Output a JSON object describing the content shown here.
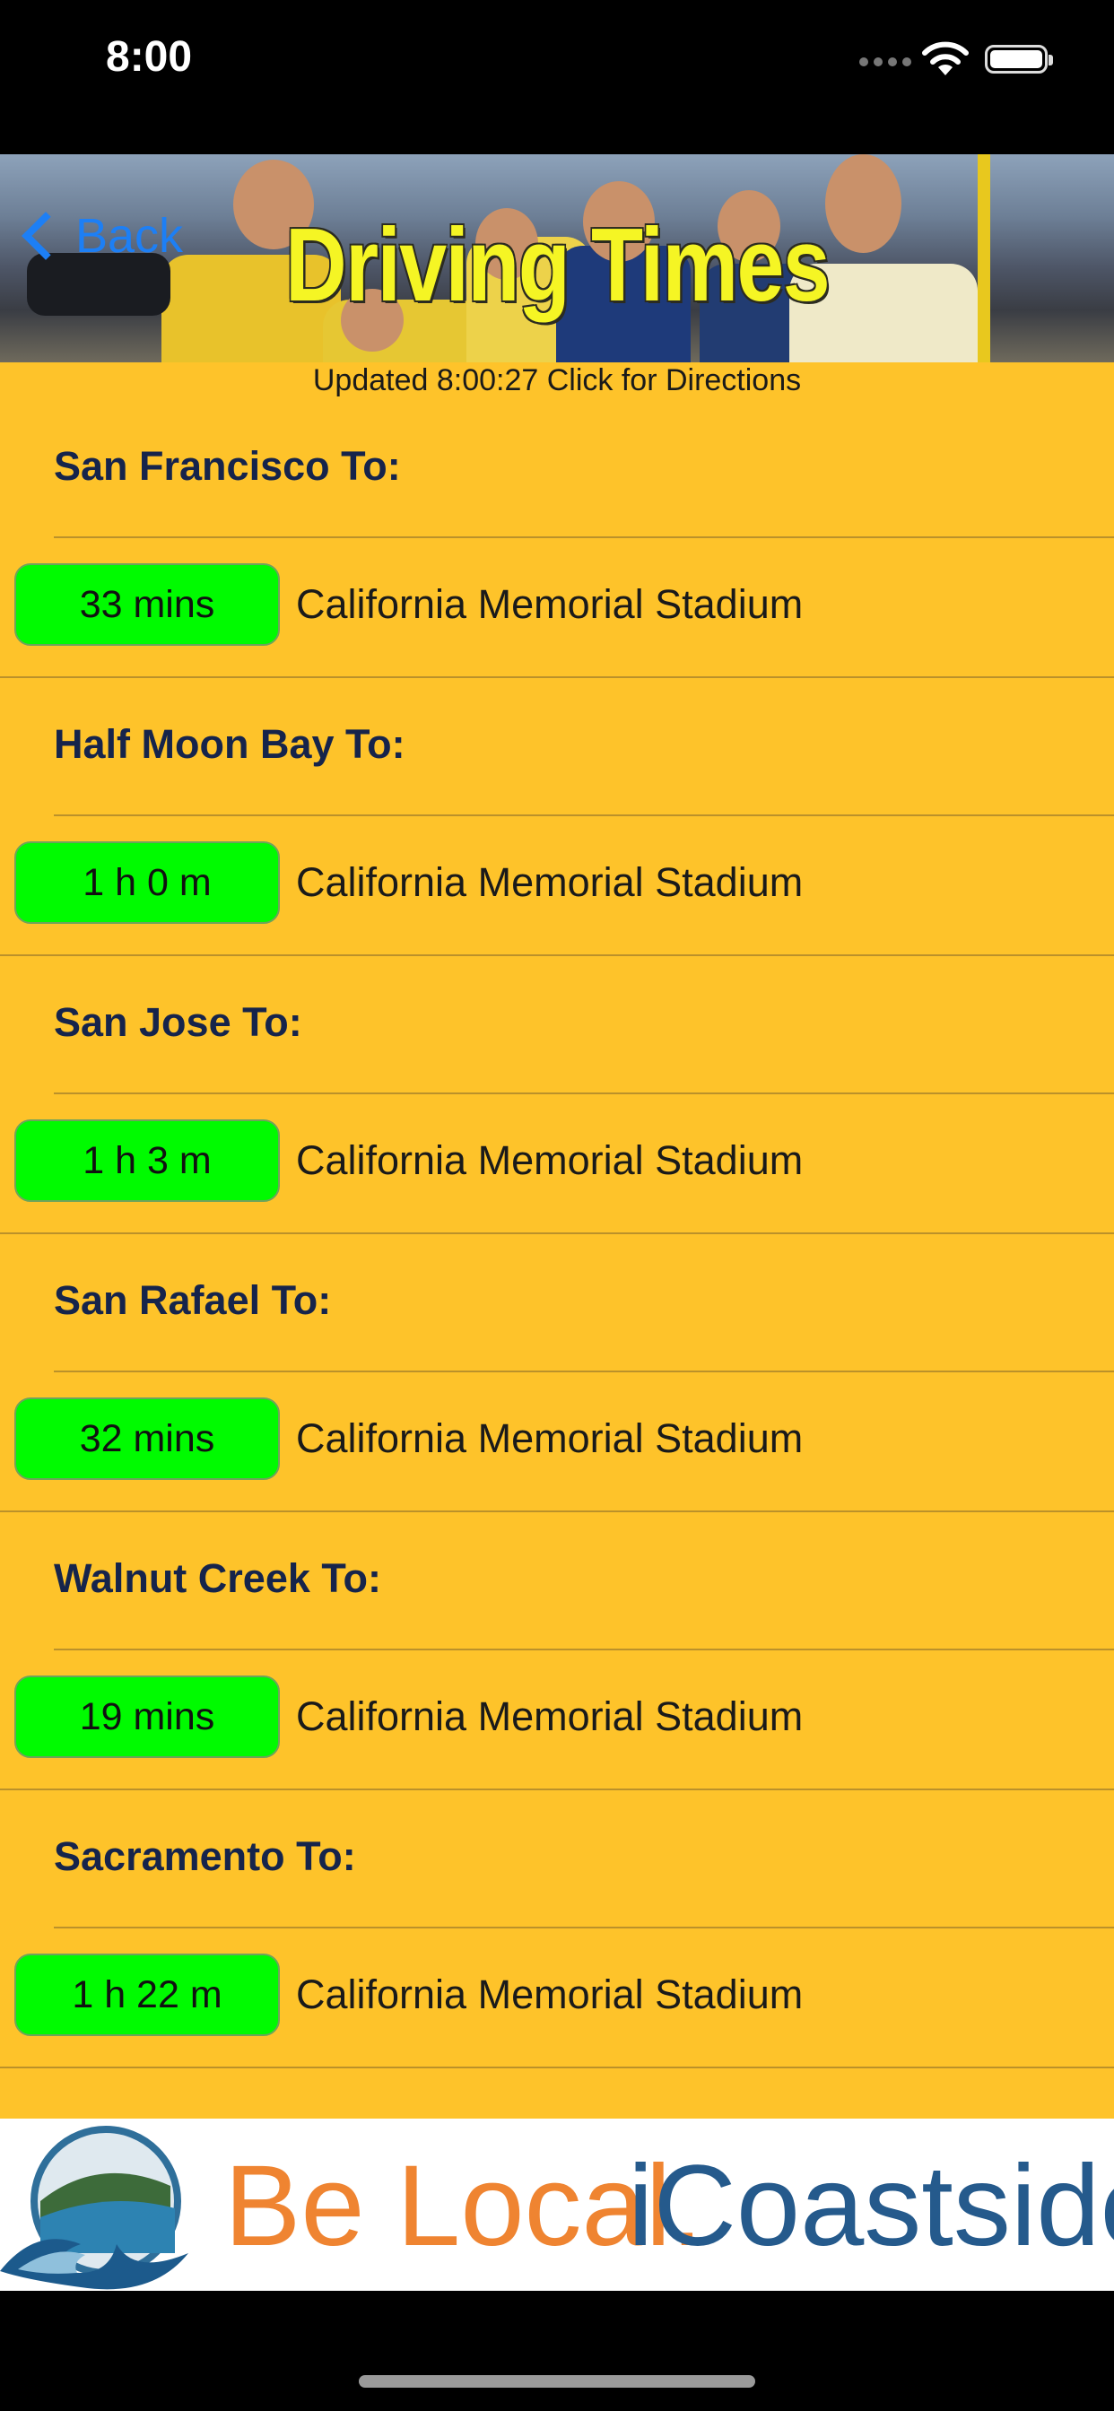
{
  "status_bar": {
    "time": "8:00"
  },
  "header": {
    "back_label": "Back",
    "title": "Driving Times"
  },
  "updated_text": "Updated 8:00:27 Click for Directions",
  "routes": [
    {
      "origin": "San Francisco To:",
      "duration": "33 mins",
      "destination": "California Memorial Stadium"
    },
    {
      "origin": "Half Moon Bay To:",
      "duration": "1 h 0 m",
      "destination": "California Memorial Stadium"
    },
    {
      "origin": "San Jose To:",
      "duration": "1 h 3 m",
      "destination": "California Memorial Stadium"
    },
    {
      "origin": "San Rafael To:",
      "duration": "32 mins",
      "destination": "California Memorial Stadium"
    },
    {
      "origin": "Walnut Creek To:",
      "duration": "19 mins",
      "destination": "California Memorial Stadium"
    },
    {
      "origin": "Sacramento To:",
      "duration": "1 h 22 m",
      "destination": "California Memorial Stadium"
    }
  ],
  "ad": {
    "text1": "Be Local.",
    "text2": "iCoastside"
  },
  "colors": {
    "background": "#fec32a",
    "duration_button": "#00fb00",
    "title": "#f5f524",
    "back_link": "#1d7ff5",
    "ad_orange": "#ef8431",
    "ad_blue": "#255a8c"
  },
  "icons": [
    "signal-icon",
    "wifi-icon",
    "battery-icon",
    "chevron-left-icon",
    "icoastside-logo"
  ]
}
